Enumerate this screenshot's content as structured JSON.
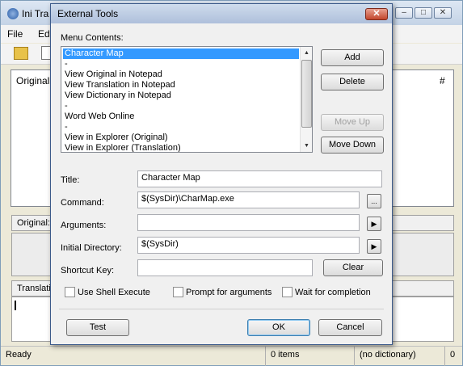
{
  "main": {
    "title": "Ini Tra",
    "menu": {
      "file": "File",
      "edit": "Ed"
    },
    "list_columns": {
      "original": "Original",
      "hash": "#"
    },
    "original_panel_label": "Original:",
    "translation_panel_label": "Translati",
    "status": {
      "ready": "Ready",
      "items": "0 items",
      "dictionary": "(no dictionary)",
      "last": "0"
    }
  },
  "dialog": {
    "title": "External Tools",
    "close_glyph": "✕",
    "menu_contents_label": "Menu Contents:",
    "menu_items": [
      "Character Map",
      "-",
      "View Original in Notepad",
      "View Translation in Notepad",
      "View Dictionary in Notepad",
      "-",
      "Word Web Online",
      "-",
      "View in Explorer (Original)",
      "View in Explorer (Translation)"
    ],
    "selected_index": 0,
    "buttons": {
      "add": "Add",
      "delete": "Delete",
      "move_up": "Move Up",
      "move_down": "Move Down",
      "clear": "Clear",
      "test": "Test",
      "ok": "OK",
      "cancel": "Cancel",
      "browse": "..."
    },
    "fields": {
      "title_label": "Title:",
      "title_value": "Character Map",
      "command_label": "Command:",
      "command_value": "$(SysDir)\\CharMap.exe",
      "arguments_label": "Arguments:",
      "arguments_value": "",
      "initial_dir_label": "Initial Directory:",
      "initial_dir_value": "$(SysDir)",
      "shortcut_label": "Shortcut Key:",
      "shortcut_value": ""
    },
    "checkboxes": {
      "shell_execute": "Use Shell Execute",
      "prompt_args": "Prompt for arguments",
      "wait_completion": "Wait for completion"
    }
  }
}
